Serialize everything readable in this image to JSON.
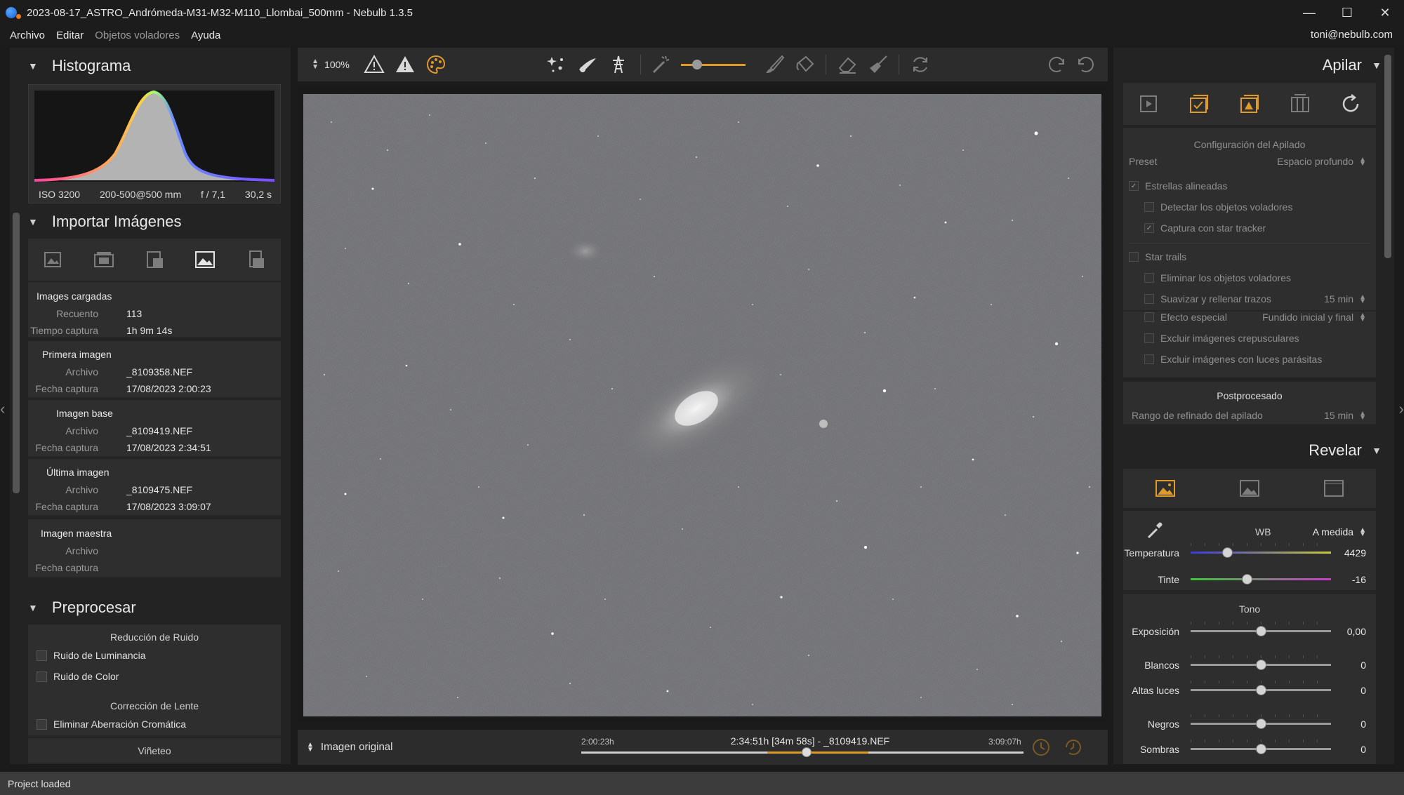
{
  "window": {
    "title": "2023-08-17_ASTRO_Andrómeda-M31-M32-M110_Llombai_500mm - Nebulb 1.3.5",
    "minimize": "—",
    "maximize": "☐",
    "close": "✕"
  },
  "menu": {
    "items": [
      "Archivo",
      "Editar",
      "Objetos voladores",
      "Ayuda"
    ],
    "user": "toni@nebulb.com"
  },
  "status": "Project loaded",
  "histogram": {
    "title": "Histograma",
    "iso": "ISO 3200",
    "focal": "200-500@500 mm",
    "aperture": "f / 7,1",
    "exposure": "30,2 s"
  },
  "import": {
    "title": "Importar Imágenes",
    "loaded": {
      "title": "Images cargadas",
      "count_label": "Recuento",
      "count": "113",
      "time_label": "Tiempo captura",
      "time": "1h 9m 14s"
    },
    "first": {
      "title": "Primera imagen",
      "file_label": "Archivo",
      "file": "_8109358.NEF",
      "date_label": "Fecha captura",
      "date": "17/08/2023 2:00:23"
    },
    "base": {
      "title": "Imagen base",
      "file_label": "Archivo",
      "file": "_8109419.NEF",
      "date_label": "Fecha captura",
      "date": "17/08/2023 2:34:51"
    },
    "last": {
      "title": "Última imagen",
      "file_label": "Archivo",
      "file": "_8109475.NEF",
      "date_label": "Fecha captura",
      "date": "17/08/2023 3:09:07"
    },
    "master": {
      "title": "Imagen maestra",
      "file_label": "Archivo",
      "date_label": "Fecha captura"
    }
  },
  "preprocess": {
    "title": "Preprocesar",
    "noise_heading": "Reducción de Ruido",
    "luminance": "Ruido de Luminancia",
    "color": "Ruido de Color",
    "lens_heading": "Corrección de Lente",
    "chromatic": "Eliminar Aberración Cromática",
    "vignette": "Viñeteo"
  },
  "toolbar": {
    "zoom": "100%"
  },
  "timeline": {
    "mode": "Imagen original",
    "start": "2:00:23h",
    "end": "3:09:07h",
    "current": "2:34:51h [34m 58s] - _8109419.NEF",
    "position": 0.51,
    "range_start": 0.42,
    "range_end": 0.65
  },
  "stack": {
    "title": "Apilar",
    "config_heading": "Configuración del Apilado",
    "preset_label": "Preset",
    "preset_value": "Espacio profundo",
    "aligned": "Estrellas alineadas",
    "detect_flying": "Detectar los objetos voladores",
    "star_tracker": "Captura con star tracker",
    "star_trails": "Star trails",
    "remove_flying": "Eliminar los objetos voladores",
    "smooth": "Suavizar y rellenar trazos",
    "smooth_value": "15 min",
    "effect": "Efecto especial",
    "effect_value": "Fundido inicial y final",
    "exclude_twilight": "Excluir imágenes crepusculares",
    "exclude_stray": "Excluir imágenes con luces parásitas",
    "post_heading": "Postprocesado",
    "refine_label": "Rango de refinado del apilado",
    "refine_value": "15 min"
  },
  "develop": {
    "title": "Revelar",
    "wb_label": "WB",
    "wb_value": "A medida",
    "temperature_label": "Temperatura",
    "temperature": "4429",
    "temperature_pos": 0.26,
    "tint_label": "Tinte",
    "tint": "-16",
    "tint_pos": 0.4,
    "tone_heading": "Tono",
    "exposure_label": "Exposición",
    "exposure": "0,00",
    "whites_label": "Blancos",
    "whites": "0",
    "highlights_label": "Altas luces",
    "highlights": "0",
    "blacks_label": "Negros",
    "blacks": "0",
    "shadows_label": "Sombras",
    "shadows": "0"
  },
  "colors": {
    "accent": "#e09a2a",
    "panel": "#2e2e2e",
    "sky": "#6f7073"
  }
}
